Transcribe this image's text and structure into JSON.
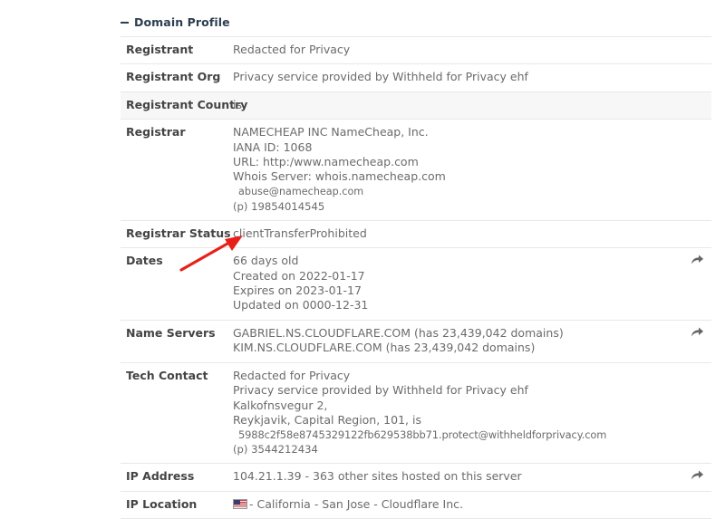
{
  "section": {
    "title": "Domain Profile",
    "collapse_icon": "minus-icon"
  },
  "icons": {
    "share": "share-arrow-icon",
    "flag": "us-flag-icon"
  },
  "colors": {
    "header_text": "#2c3e50",
    "label_text": "#444444",
    "value_text": "#6b6b6b",
    "row_shaded_bg": "#f7f7f7",
    "row_bg": "#ffffff",
    "row_border": "#e8e8e8",
    "annotation_arrow": "#e8201a"
  },
  "rows": [
    {
      "label": "Registrant",
      "lines": [
        {
          "text": "Redacted for Privacy",
          "style": "normal"
        }
      ],
      "shaded": false,
      "has_share": false
    },
    {
      "label": "Registrant Org",
      "lines": [
        {
          "text": "Privacy service provided by Withheld for Privacy ehf",
          "style": "normal"
        }
      ],
      "shaded": false,
      "has_share": false
    },
    {
      "label": "Registrant Country",
      "lines": [
        {
          "text": "is",
          "style": "normal"
        }
      ],
      "shaded": true,
      "has_share": false
    },
    {
      "label": "Registrar",
      "lines": [
        {
          "text": "NAMECHEAP INC NameCheap, Inc.",
          "style": "normal"
        },
        {
          "text": "IANA ID: 1068",
          "style": "normal"
        },
        {
          "text": "URL: http:/www.namecheap.com",
          "style": "normal"
        },
        {
          "text": "Whois Server: whois.namecheap.com",
          "style": "normal"
        },
        {
          "text": "abuse@namecheap.com",
          "style": "small"
        },
        {
          "text": "(p) 19854014545",
          "style": "small-plain"
        }
      ],
      "shaded": false,
      "has_share": false
    },
    {
      "label": "Registrar Status",
      "lines": [
        {
          "text": "clientTransferProhibited",
          "style": "normal"
        }
      ],
      "shaded": false,
      "has_share": false
    },
    {
      "label": "Dates",
      "lines": [
        {
          "text": "66 days old",
          "style": "normal"
        },
        {
          "text": "Created on 2022-01-17",
          "style": "normal"
        },
        {
          "text": "Expires on 2023-01-17",
          "style": "normal"
        },
        {
          "text": "Updated on 0000-12-31",
          "style": "normal"
        }
      ],
      "shaded": false,
      "has_share": true
    },
    {
      "label": "Name Servers",
      "lines": [
        {
          "text": "GABRIEL.NS.CLOUDFLARE.COM (has 23,439,042 domains)",
          "style": "normal"
        },
        {
          "text": "KIM.NS.CLOUDFLARE.COM (has 23,439,042 domains)",
          "style": "normal"
        }
      ],
      "shaded": false,
      "has_share": true
    },
    {
      "label": "Tech Contact",
      "lines": [
        {
          "text": "Redacted for Privacy",
          "style": "normal"
        },
        {
          "text": "Privacy service provided by Withheld for Privacy ehf",
          "style": "normal"
        },
        {
          "text": "Kalkofnsvegur 2,",
          "style": "normal"
        },
        {
          "text": "Reykjavik, Capital Region, 101, is",
          "style": "normal"
        },
        {
          "text": "5988c2f58e8745329122fb629538bb71.protect@withheldforprivacy.com",
          "style": "hash-email"
        },
        {
          "text": "(p) 3544212434",
          "style": "small-plain"
        }
      ],
      "shaded": false,
      "has_share": false
    },
    {
      "label": "IP Address",
      "lines": [
        {
          "text": "104.21.1.39 - 363 other sites hosted on this server",
          "style": "normal"
        }
      ],
      "shaded": false,
      "has_share": true
    },
    {
      "label": "IP Location",
      "lines": [
        {
          "text": "- California - San Jose - Cloudflare Inc.",
          "style": "flag"
        }
      ],
      "shaded": false,
      "has_share": false
    }
  ]
}
